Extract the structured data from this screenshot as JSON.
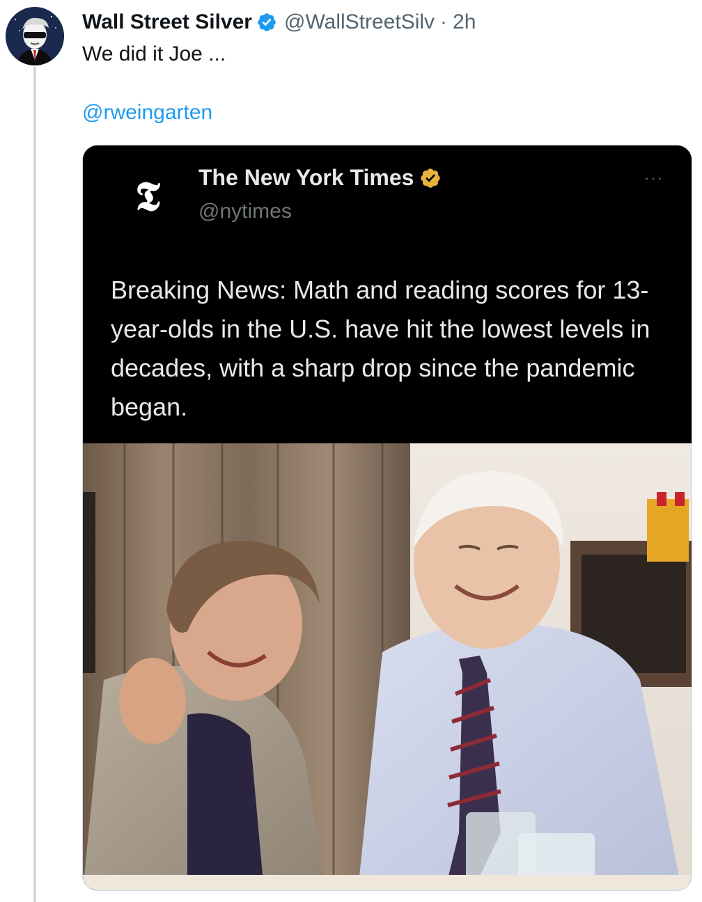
{
  "tweet": {
    "author_name": "Wall Street Silver",
    "author_handle": "@WallStreetSilv",
    "separator": "·",
    "time": "2h",
    "text": "We did it Joe ...",
    "mention": "@rweingarten"
  },
  "embedded_post": {
    "author_name": "The New York Times",
    "author_handle": "@nytimes",
    "logo_glyph": "𝕿",
    "more": "···",
    "text": "Breaking News: Math and reading scores for 13-year-olds in the U.S. have hit the lowest levels in decades, with a sharp drop since the pandemic began."
  },
  "colors": {
    "link": "#1d9bf0",
    "verified_blue": "#1d9bf0",
    "verified_gold": "#e8b33c",
    "secondary_text": "#536471"
  },
  "icons": {
    "verified": "verified-badge-icon",
    "gold_verified": "gold-verified-badge-icon",
    "more": "more-options-icon"
  }
}
